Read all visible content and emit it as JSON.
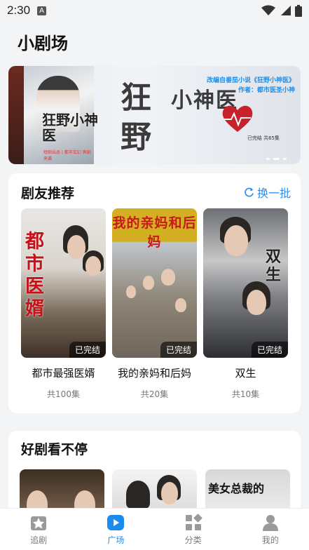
{
  "status_bar": {
    "time": "2:30",
    "notification_icon": "a-notification-icon",
    "icons": [
      "wifi-icon",
      "signal-icon",
      "battery-icon"
    ]
  },
  "header": {
    "title": "小剧场"
  },
  "banner": {
    "poster_title": "狂野小神医",
    "poster_sub": "短剧出品 | 都市玄幻 爽剧来袭",
    "title_main": "狂野",
    "title_sub": "小神医",
    "side_line1": "改编自番茄小说《狂野小神医》",
    "side_line2": "作者：都市医圣小神",
    "episodes_text": "已完结 共65集",
    "page_count": 3,
    "active_page": 1
  },
  "recommend": {
    "title": "剧友推荐",
    "refresh_label": "换一批",
    "items": [
      {
        "name": "都市最强医婿",
        "episodes": "共100集",
        "badge": "已完结",
        "cover_text": "都市医婿"
      },
      {
        "name": "我的亲妈和后妈",
        "episodes": "共20集",
        "badge": "已完结",
        "cover_text": "我的亲妈和后妈"
      },
      {
        "name": "双生",
        "episodes": "共10集",
        "badge": "已完结",
        "cover_text": "双生"
      }
    ]
  },
  "nonstop": {
    "title": "好剧看不停",
    "items": [
      {
        "cover_text": ""
      },
      {
        "cover_text": ""
      },
      {
        "cover_text": "美女总裁的"
      }
    ]
  },
  "bottom_nav": {
    "items": [
      {
        "label": "追剧",
        "icon": "star-icon",
        "active": false
      },
      {
        "label": "广场",
        "icon": "play-icon",
        "active": true
      },
      {
        "label": "分类",
        "icon": "category-icon",
        "active": false
      },
      {
        "label": "我的",
        "icon": "person-icon",
        "active": false
      }
    ]
  },
  "colors": {
    "accent": "#1a8cf0",
    "refresh": "#2b8def",
    "background": "#f3f4f6"
  }
}
